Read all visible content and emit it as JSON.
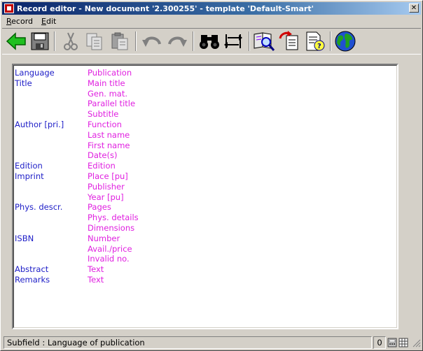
{
  "window": {
    "title": "Record editor - New document '2.300255' - template 'Default-Smart'",
    "close_glyph": "✕"
  },
  "menu": [
    {
      "label_ul": "R",
      "label_rest": "ecord"
    },
    {
      "label_ul": "E",
      "label_rest": "dit"
    }
  ],
  "toolbar": {
    "icons": [
      "back-arrow-icon",
      "save-disk-icon",
      "cut-scissors-icon",
      "copy-icon",
      "paste-icon",
      "undo-icon",
      "redo-icon",
      "find-binoculars-icon",
      "swap-arrows-icon",
      "view-record-icon",
      "copy-record-icon",
      "validate-record-icon",
      "globe-icon"
    ]
  },
  "record": {
    "rows": [
      {
        "field": "Language",
        "subfield": "Publication"
      },
      {
        "field": "Title",
        "subfield": "Main title"
      },
      {
        "field": "",
        "subfield": "Gen. mat."
      },
      {
        "field": "",
        "subfield": "Parallel title"
      },
      {
        "field": "",
        "subfield": "Subtitle"
      },
      {
        "field": "Author [pri.]",
        "subfield": "Function"
      },
      {
        "field": "",
        "subfield": "Last name"
      },
      {
        "field": "",
        "subfield": "First name"
      },
      {
        "field": "",
        "subfield": "Date(s)"
      },
      {
        "field": "Edition",
        "subfield": "Edition"
      },
      {
        "field": "Imprint",
        "subfield": "Place [pu]"
      },
      {
        "field": "",
        "subfield": "Publisher"
      },
      {
        "field": "",
        "subfield": "Year [pu]"
      },
      {
        "field": "Phys. descr.",
        "subfield": "Pages"
      },
      {
        "field": "",
        "subfield": "Phys. details"
      },
      {
        "field": "",
        "subfield": "Dimensions"
      },
      {
        "field": "ISBN",
        "subfield": "Number"
      },
      {
        "field": "",
        "subfield": "Avail./price"
      },
      {
        "field": "",
        "subfield": "Invalid no."
      },
      {
        "field": "Abstract",
        "subfield": "Text"
      },
      {
        "field": "Remarks",
        "subfield": "Text"
      }
    ]
  },
  "status": {
    "text": "Subfield : Language of publication",
    "count": "0"
  },
  "colors": {
    "field": "#2020c8",
    "subfield": "#e020e0",
    "titlebar": "#0a246a"
  }
}
